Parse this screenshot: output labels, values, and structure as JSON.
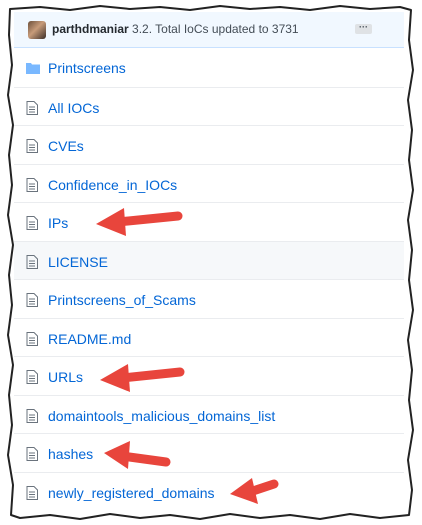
{
  "commit": {
    "user": "parthdmaniar",
    "message": "3.2. Total IoCs updated to 3731",
    "ellipsis": "···"
  },
  "files": [
    {
      "name": "Printscreens",
      "type": "folder"
    },
    {
      "name": "All IOCs",
      "type": "file"
    },
    {
      "name": "CVEs",
      "type": "file"
    },
    {
      "name": "Confidence_in_IOCs",
      "type": "file"
    },
    {
      "name": "IPs",
      "type": "file"
    },
    {
      "name": "LICENSE",
      "type": "file"
    },
    {
      "name": "Printscreens_of_Scams",
      "type": "file"
    },
    {
      "name": "README.md",
      "type": "file"
    },
    {
      "name": "URLs",
      "type": "file"
    },
    {
      "name": "domaintools_malicious_domains_list",
      "type": "file"
    },
    {
      "name": "hashes",
      "type": "file"
    },
    {
      "name": "newly_registered_domains",
      "type": "file"
    }
  ],
  "highlighted_row": "LICENSE",
  "arrow_color": "#e8453c",
  "link_color": "#0366d6"
}
